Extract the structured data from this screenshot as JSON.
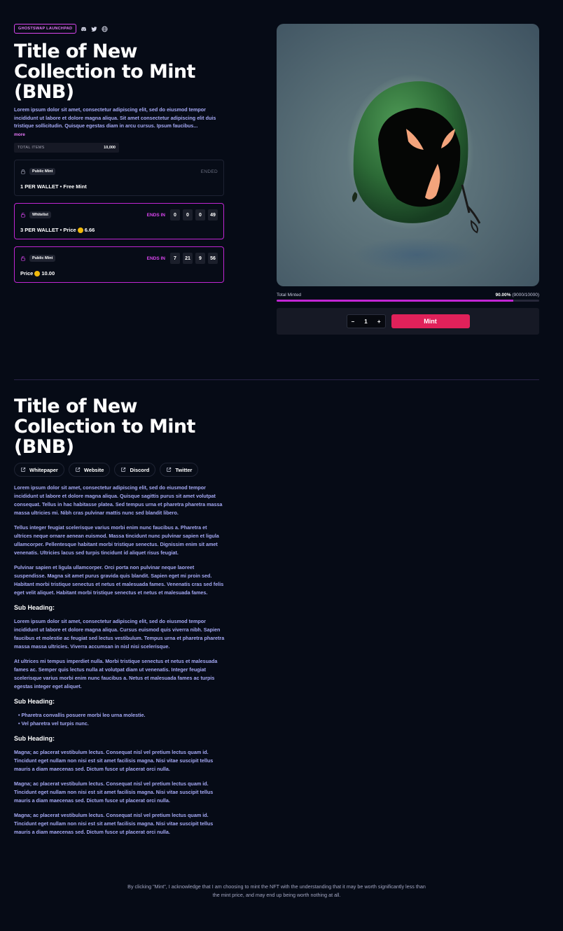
{
  "header": {
    "badge": "GHOSTSWAP LAUNCHPAD",
    "title": "Title of New Collection to Mint (BNB)",
    "description": "Lorem ipsum dolor sit amet, consectetur adipiscing elit, sed do eiusmod tempor incididunt ut labore et dolore magna aliqua. Sit amet consectetur adipiscing elit duis tristique sollicitudin. Quisque egestas diam in arcu cursus. Ipsum faucibus...",
    "more_label": "more",
    "total_items_label": "TOTAL ITEMS",
    "total_items_value": "10,000"
  },
  "phases": [
    {
      "tag": "Public Mint",
      "status": "ENDED",
      "info": "1 PER WALLET • Free Mint"
    },
    {
      "tag": "Whitelist",
      "ends_in_label": "ENDS IN",
      "countdown": [
        "0",
        "0",
        "0",
        "49"
      ],
      "info_prefix": "3 PER WALLET • Price",
      "price": "6.66"
    },
    {
      "tag": "Public Mint",
      "ends_in_label": "ENDS IN",
      "countdown": [
        "7",
        "21",
        "9",
        "56"
      ],
      "info_prefix": "Price",
      "price": "10.00"
    }
  ],
  "minting": {
    "total_minted_label": "Total Minted",
    "percent": "90.00%",
    "count": "(9000/10000)",
    "progress_fraction": 0.9,
    "quantity": "1",
    "minus": "−",
    "plus": "+",
    "mint_label": "Mint"
  },
  "details": {
    "title": "Title of New Collection to Mint (BNB)",
    "links": [
      "Whitepaper",
      "Website",
      "Discord",
      "Twitter"
    ],
    "paragraphs": [
      "Lorem ipsum dolor sit amet, consectetur adipiscing elit, sed do eiusmod tempor incididunt ut labore et dolore magna aliqua. Quisque sagittis purus sit amet volutpat consequat. Tellus in hac habitasse platea. Sed tempus urna et pharetra pharetra massa massa ultricies mi. Nibh cras pulvinar mattis nunc sed blandit libero.",
      "Tellus integer feugiat scelerisque varius morbi enim nunc faucibus a. Pharetra et ultrices neque ornare aenean euismod. Massa tincidunt nunc pulvinar sapien et ligula ullamcorper. Pellentesque habitant morbi tristique senectus. Dignissim enim sit amet venenatis. Ultricies lacus sed turpis tincidunt id aliquet risus feugiat.",
      "Pulvinar sapien et ligula ullamcorper. Orci porta non pulvinar neque laoreet suspendisse. Magna sit amet purus gravida quis blandit. Sapien eget mi proin sed. Habitant morbi tristique senectus et netus et malesuada fames. Venenatis cras sed felis eget velit aliquet. Habitant morbi tristique senectus et netus et malesuada fames."
    ],
    "sub1": "Sub Heading:",
    "sub1_paragraphs": [
      "Lorem ipsum dolor sit amet, consectetur adipiscing elit, sed do eiusmod tempor incididunt ut labore et dolore magna aliqua. Cursus euismod quis viverra nibh. Sapien faucibus et molestie ac feugiat sed lectus vestibulum. Tempus urna et pharetra pharetra massa massa ultricies. Viverra accumsan in nisl nisi scelerisque.",
      "At ultrices mi tempus imperdiet nulla. Morbi tristique senectus et netus et malesuada fames ac. Semper quis lectus nulla at volutpat diam ut venenatis. Integer feugiat scelerisque varius morbi enim nunc faucibus a. Netus et malesuada fames ac turpis egestas integer eget aliquet."
    ],
    "sub2": "Sub Heading:",
    "bullets": [
      "Pharetra convallis posuere morbi leo urna molestie.",
      "Vel pharetra vel turpis nunc."
    ],
    "sub3": "Sub Heading:",
    "sub3_paragraphs": [
      "Magna; ac placerat vestibulum lectus. Consequat nisl vel pretium lectus quam id. Tincidunt eget nullam non nisi est sit amet facilisis magna. Nisi vitae suscipit tellus mauris a diam maecenas sed. Dictum fusce ut placerat orci nulla.",
      "Magna; ac placerat vestibulum lectus. Consequat nisl vel pretium lectus quam id. Tincidunt eget nullam non nisi est sit amet facilisis magna. Nisi vitae suscipit tellus mauris a diam maecenas sed. Dictum fusce ut placerat orci nulla.",
      "Magna; ac placerat vestibulum lectus. Consequat nisl vel pretium lectus quam id. Tincidunt eget nullam non nisi est sit amet facilisis magna. Nisi vitae suscipit tellus mauris a diam maecenas sed. Dictum fusce ut placerat orci nulla."
    ]
  },
  "disclaimer": "By clicking \"Mint\", I acknowledge that I am choosing to mint the NFT with the understanding that it may be worth significantly less than the mint price, and may end up being worth nothing at all.",
  "icons": {
    "social": [
      "discord-icon",
      "twitter-icon",
      "globe-icon"
    ],
    "lock": "lock-icon",
    "unlock": "unlock-icon",
    "external_link": "external-link-icon",
    "coin": "bnb-coin-icon"
  },
  "colors": {
    "background": "#060b16",
    "accent": "#c026d3",
    "mint_button": "#e0215a",
    "text_body": "#a5a9f5"
  }
}
